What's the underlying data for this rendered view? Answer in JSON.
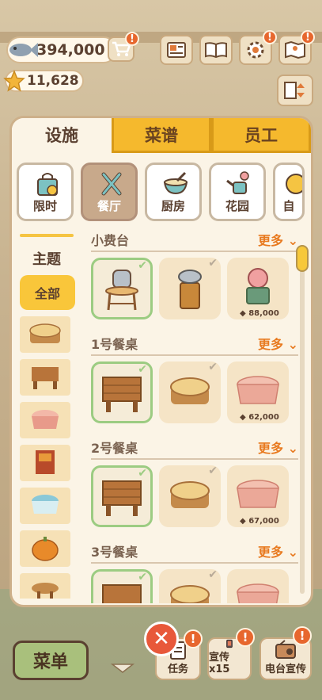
{
  "hud": {
    "coins": "394,000",
    "stars": "11,628",
    "alert_mark": "!"
  },
  "tabs": [
    {
      "label": "设施",
      "active": true
    },
    {
      "label": "菜谱",
      "active": false
    },
    {
      "label": "员工",
      "active": false
    }
  ],
  "categories": [
    {
      "label": "限时",
      "icon": "shopping-bag-icon",
      "active": false
    },
    {
      "label": "餐厅",
      "icon": "utensils-icon",
      "active": true
    },
    {
      "label": "厨房",
      "icon": "mixing-bowl-icon",
      "active": false
    },
    {
      "label": "花园",
      "icon": "watering-can-icon",
      "active": false
    },
    {
      "label": "自",
      "icon": "partial-icon",
      "active": false
    }
  ],
  "sidebar": {
    "title": "主题",
    "all_label": "全部",
    "themes": [
      "tree-stump-theme-icon",
      "wood-table-theme-icon",
      "gingham-table-theme-icon",
      "rug-theme-icon",
      "striped-table-theme-icon",
      "pumpkin-theme-icon",
      "round-wood-theme-icon"
    ]
  },
  "sections": [
    {
      "title": "小费台",
      "more": "更多",
      "items": [
        {
          "icon": "jar-stool-tip-stand-icon",
          "owned": true,
          "price": ""
        },
        {
          "icon": "stump-tip-stand-icon",
          "owned": false,
          "price": ""
        },
        {
          "icon": "pig-bank-stand-icon",
          "owned": false,
          "price": "88,000"
        }
      ]
    },
    {
      "title": "1号餐桌",
      "more": "更多",
      "items": [
        {
          "icon": "wood-table-icon",
          "owned": true,
          "price": ""
        },
        {
          "icon": "stump-table-icon",
          "owned": false,
          "price": ""
        },
        {
          "icon": "gingham-table-icon",
          "owned": false,
          "price": "62,000"
        }
      ]
    },
    {
      "title": "2号餐桌",
      "more": "更多",
      "items": [
        {
          "icon": "wood-table-icon",
          "owned": true,
          "price": ""
        },
        {
          "icon": "stump-table-icon",
          "owned": false,
          "price": ""
        },
        {
          "icon": "gingham-table-icon",
          "owned": false,
          "price": "67,000"
        }
      ]
    },
    {
      "title": "3号餐桌",
      "more": "更多",
      "items": [
        {
          "icon": "wood-table-icon",
          "owned": true,
          "price": ""
        },
        {
          "icon": "stump-table-icon",
          "owned": false,
          "price": ""
        },
        {
          "icon": "gingham-table-icon",
          "owned": false,
          "price": ""
        }
      ]
    }
  ],
  "bottom": {
    "menu_label": "菜单",
    "close_label": "✕",
    "task_label": "任务",
    "promo_label": "宣传x15",
    "radio_label": "电台宣传"
  },
  "colors": {
    "accent": "#f5b92d",
    "owned_border": "#9ccc82",
    "more_link": "#e87a20"
  }
}
